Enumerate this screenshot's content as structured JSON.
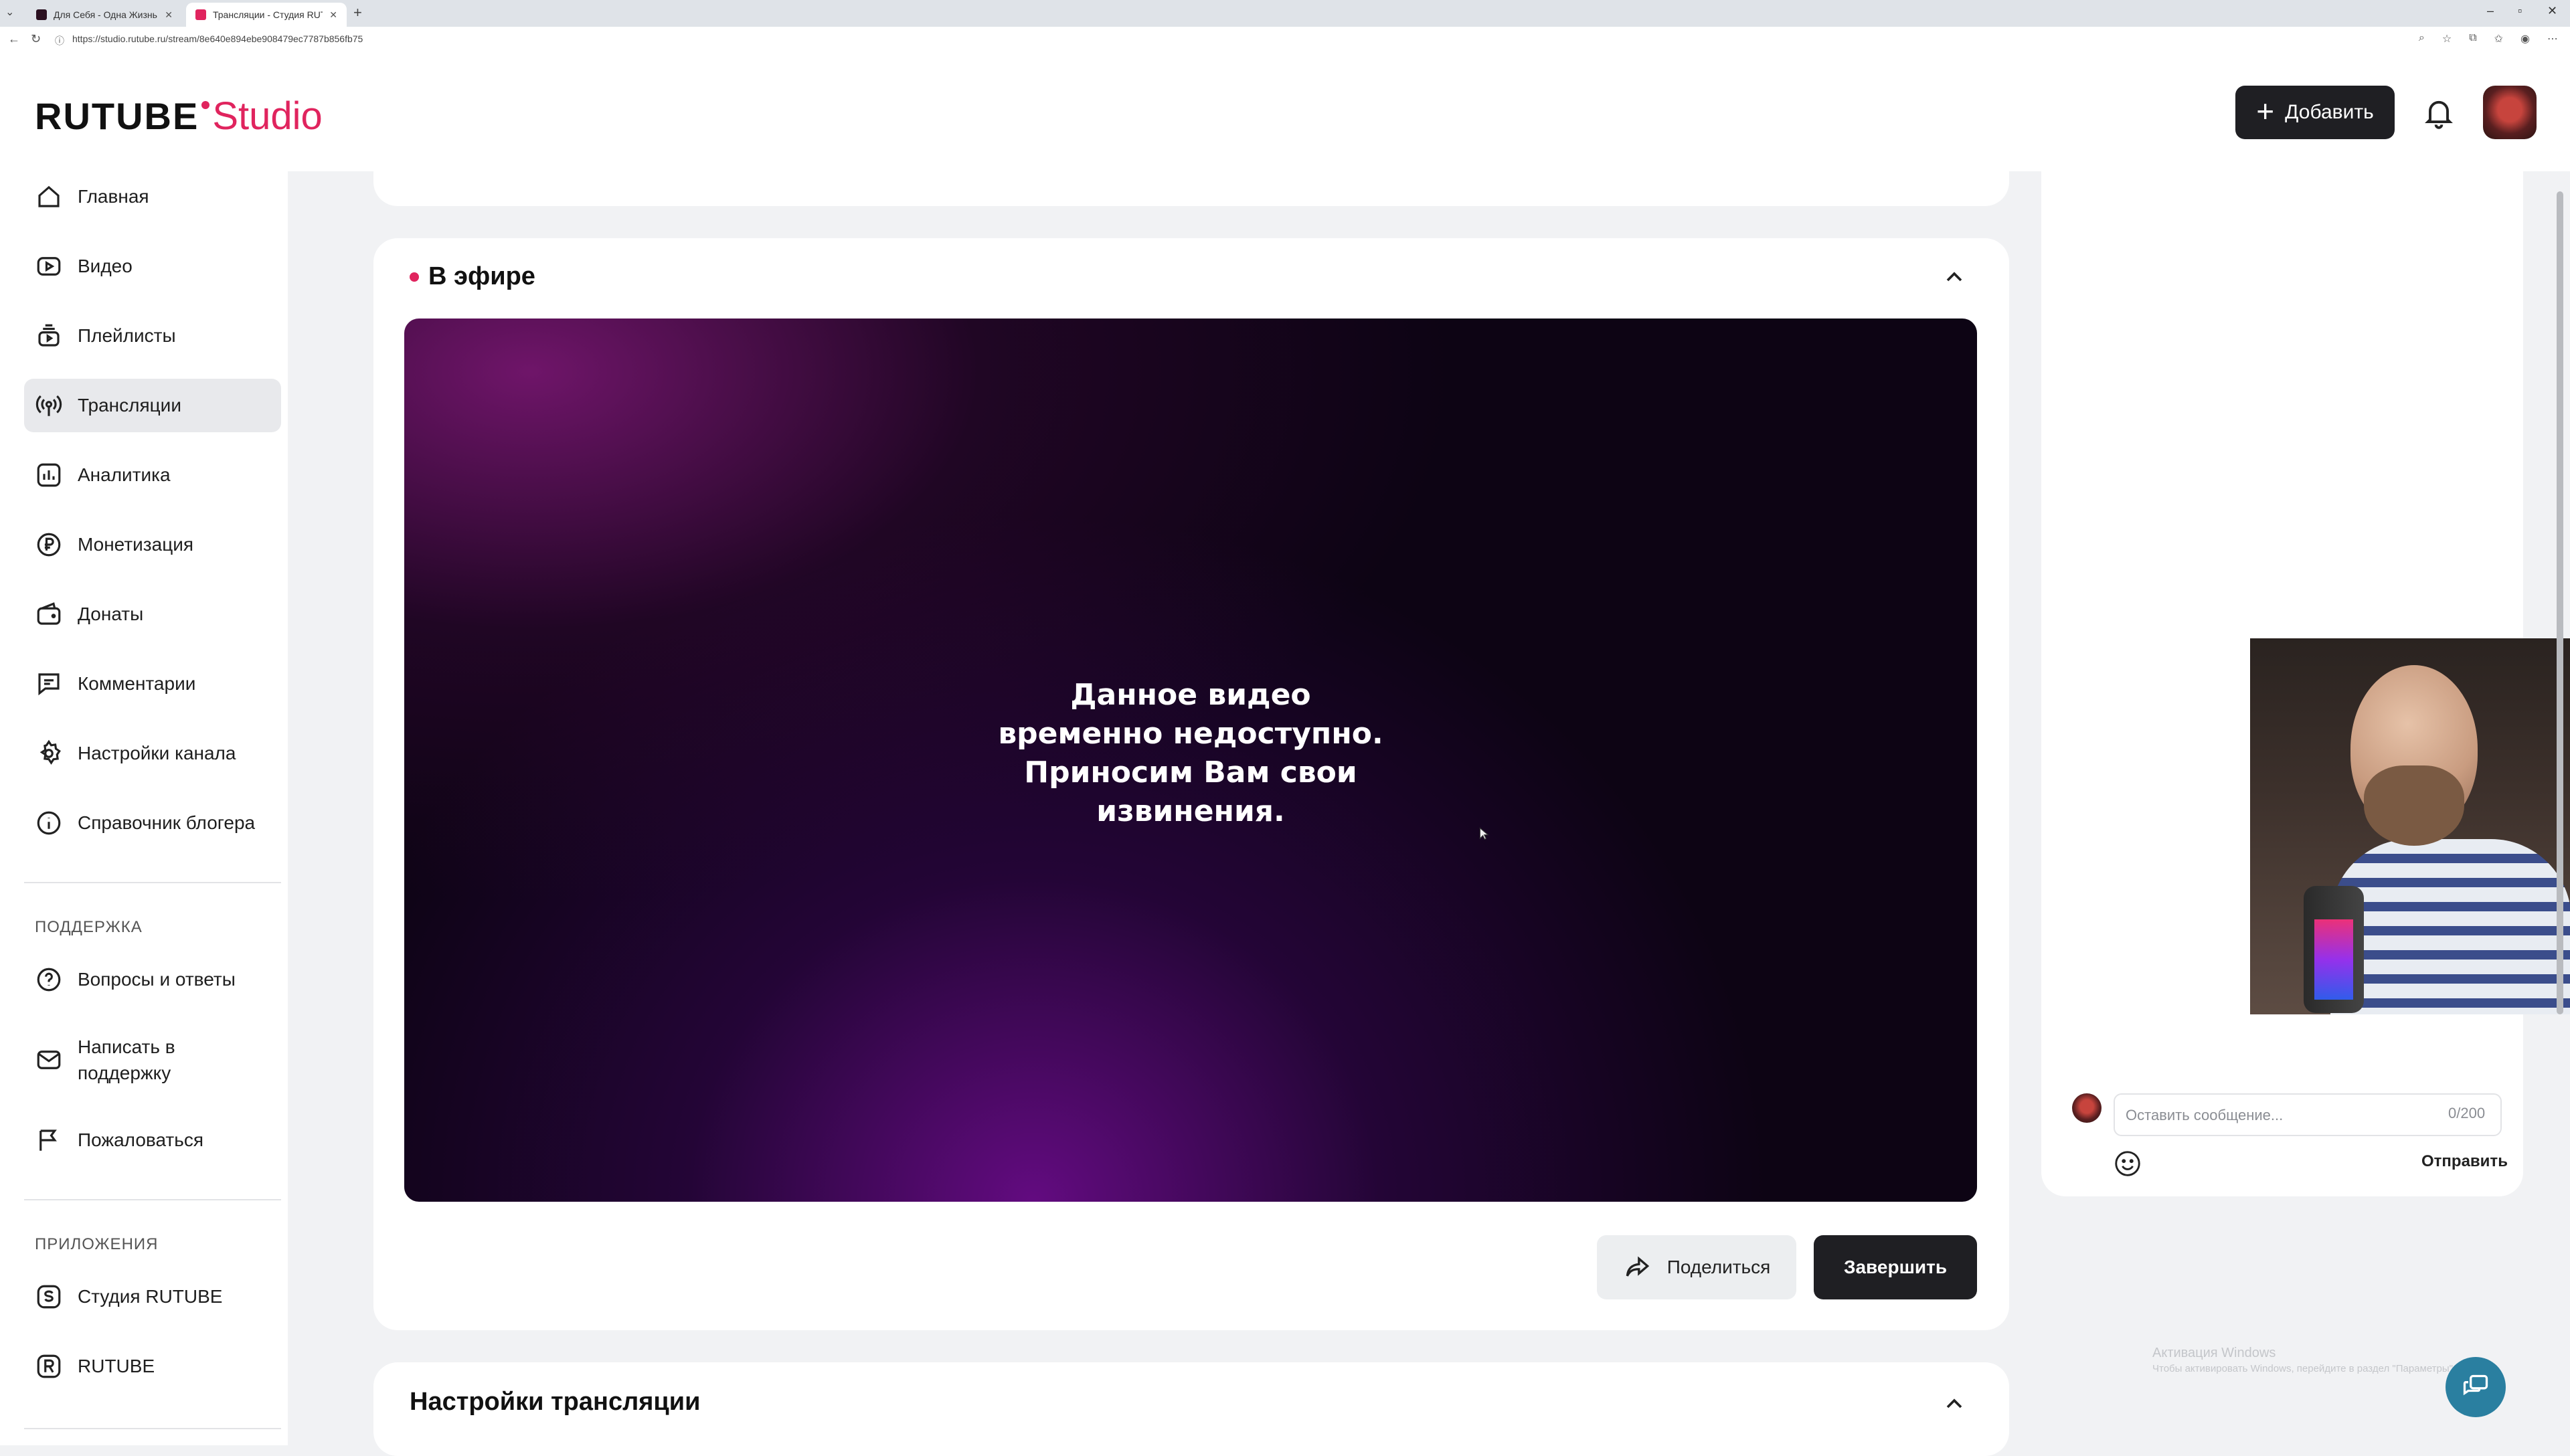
{
  "browser": {
    "tabs": [
      {
        "title": "Для Себя - Одна Жизнь - ПИЛС"
      },
      {
        "title": "Трансляции - Студия RUTUBE"
      }
    ],
    "url": "https://studio.rutube.ru/stream/8e640e894ebe908479ec7787b856fb75"
  },
  "header": {
    "logo_main": "RUTUBE",
    "logo_studio": "Studio",
    "add_label": "Добавить"
  },
  "sidebar": {
    "items": [
      {
        "label": "Главная"
      },
      {
        "label": "Видео"
      },
      {
        "label": "Плейлисты"
      },
      {
        "label": "Трансляции"
      },
      {
        "label": "Аналитика"
      },
      {
        "label": "Монетизация"
      },
      {
        "label": "Донаты"
      },
      {
        "label": "Комментарии"
      },
      {
        "label": "Настройки канала"
      },
      {
        "label": "Справочник блогера"
      }
    ],
    "support_heading": "ПОДДЕРЖКА",
    "support_items": [
      {
        "label": "Вопросы и ответы"
      },
      {
        "label": "Написать в поддержку"
      },
      {
        "label": "Пожаловаться"
      }
    ],
    "apps_heading": "ПРИЛОЖЕНИЯ",
    "app_items": [
      {
        "label": "Студия RUTUBE"
      },
      {
        "label": "RUTUBE"
      }
    ]
  },
  "stream": {
    "status_title": "В эфире",
    "player_message": [
      "Данное видео",
      "временно недоступно.",
      "Приносим Вам свои",
      "извинения."
    ],
    "share_label": "Поделиться",
    "finish_label": "Завершить"
  },
  "settings": {
    "title": "Настройки трансляции"
  },
  "chat": {
    "placeholder": "Оставить сообщение...",
    "counter": "0/200",
    "send_label": "Отправить"
  },
  "windows_activation": {
    "line1": "Активация Windows",
    "line2": "Чтобы активировать Windows, перейдите в раздел \"Параметры\"."
  },
  "colors": {
    "accent": "#e0245e",
    "dark_button": "#1f1f23",
    "page_bg": "#f1f2f4"
  }
}
